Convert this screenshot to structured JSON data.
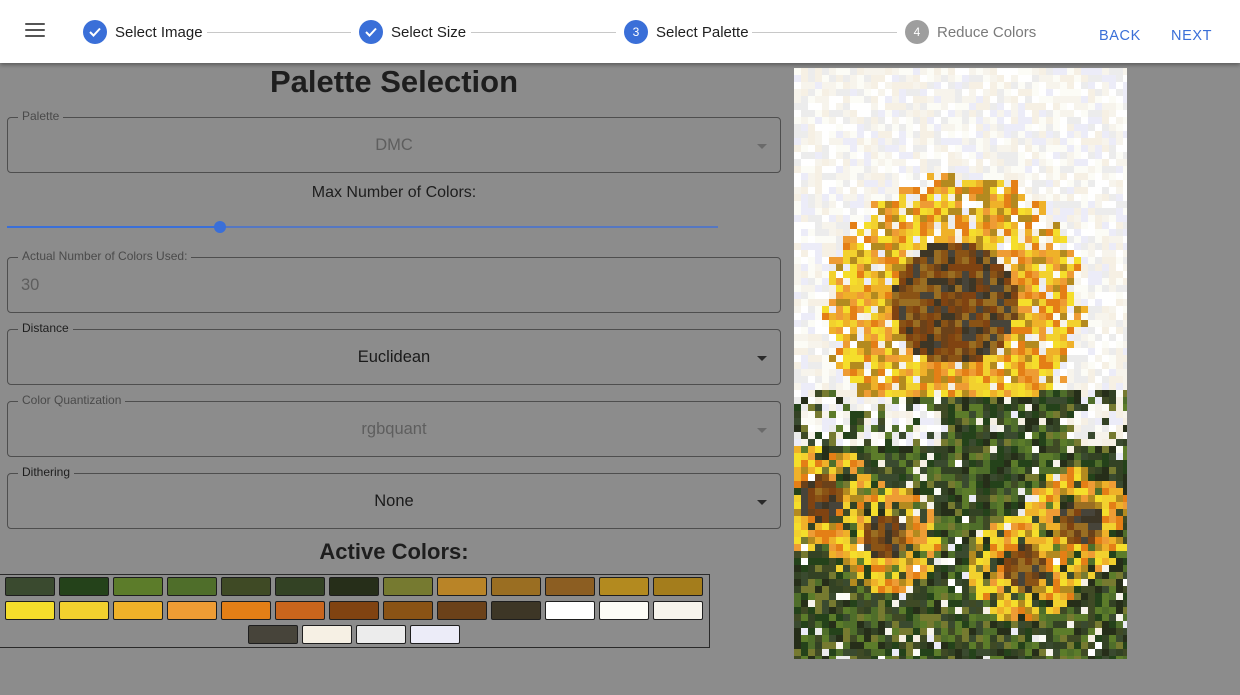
{
  "stepper": {
    "steps": [
      {
        "label": "Select Image",
        "number": "1",
        "state": "done"
      },
      {
        "label": "Select Size",
        "number": "2",
        "state": "done"
      },
      {
        "label": "Select Palette",
        "number": "3",
        "state": "active"
      },
      {
        "label": "Reduce Colors",
        "number": "4",
        "state": "inactive"
      }
    ],
    "back_label": "BACK",
    "next_label": "NEXT"
  },
  "panel": {
    "title": "Palette Selection",
    "palette": {
      "label": "Palette",
      "value": "DMC",
      "disabled": true
    },
    "max_colors": {
      "label": "Max Number of Colors:",
      "fraction": 0.3
    },
    "actual_colors": {
      "label": "Actual Number of Colors Used:",
      "value": "30",
      "disabled": true
    },
    "distance": {
      "label": "Distance",
      "value": "Euclidean"
    },
    "quantization": {
      "label": "Color Quantization",
      "value": "rgbquant",
      "disabled": true
    },
    "dithering": {
      "label": "Dithering",
      "value": "None"
    },
    "active_colors_title": "Active Colors:"
  },
  "active_colors": [
    "#3a4a2f",
    "#24421a",
    "#5c7c2a",
    "#4f6e2a",
    "#3f4a25",
    "#334224",
    "#262e19",
    "#767a30",
    "#b98427",
    "#9a6e22",
    "#8c5e22",
    "#b38a1f",
    "#a47d1c",
    "#f5de2b",
    "#f2d12e",
    "#efb129",
    "#ee9c34",
    "#e47f16",
    "#c9651c",
    "#804311",
    "#8a5315",
    "#6b4119",
    "#3d3626",
    "#ffffff",
    "#fcfcf6",
    "#f7f4ec",
    "#47443a",
    "#f6f0e4",
    "#ececec",
    "#ececf8"
  ],
  "image": {
    "alt": "pixelated sunflower preview"
  }
}
